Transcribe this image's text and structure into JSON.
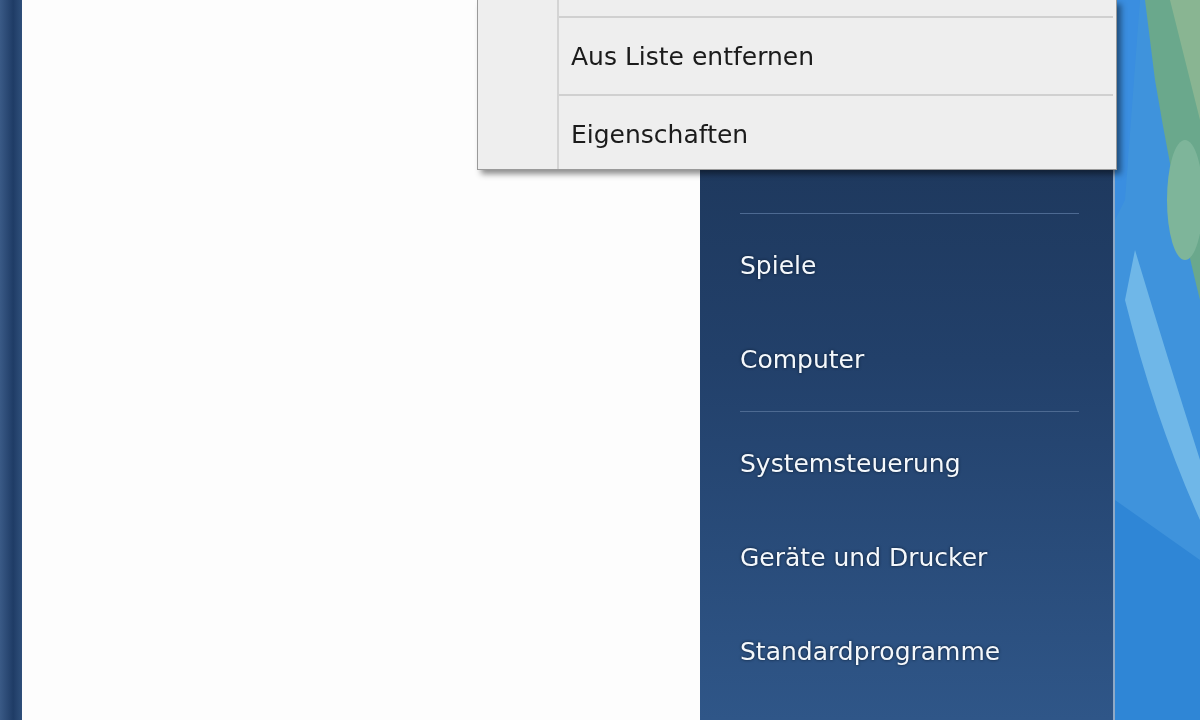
{
  "context_menu": {
    "items": [
      {
        "label": "Aus Liste entfernen"
      },
      {
        "label": "Eigenschaften"
      }
    ]
  },
  "start_menu": {
    "right_column": [
      {
        "kind": "separator"
      },
      {
        "kind": "item",
        "label": "Spiele"
      },
      {
        "kind": "item",
        "label": "Computer"
      },
      {
        "kind": "separator"
      },
      {
        "kind": "item",
        "label": "Systemsteuerung"
      },
      {
        "kind": "item",
        "label": "Geräte und Drucker"
      },
      {
        "kind": "item",
        "label": "Standardprogramme"
      }
    ]
  }
}
